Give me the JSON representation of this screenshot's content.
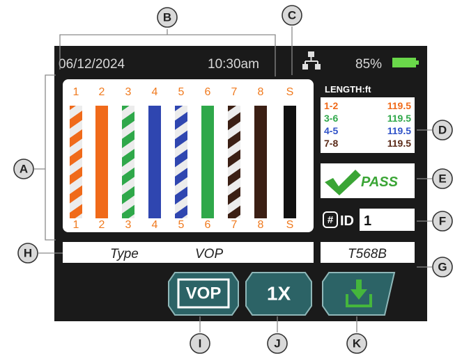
{
  "status_bar": {
    "date": "06/12/2024",
    "time": "10:30am",
    "battery": "85%"
  },
  "wiremap": {
    "pins_top": [
      "1",
      "2",
      "3",
      "4",
      "5",
      "6",
      "7",
      "8",
      "S"
    ],
    "pins_bottom": [
      "1",
      "2",
      "3",
      "4",
      "5",
      "6",
      "7",
      "8",
      "S"
    ]
  },
  "length": {
    "header": "LENGTH:ft",
    "rows": [
      {
        "pair": "1-2",
        "value": "119.5",
        "color": "#f06a1a"
      },
      {
        "pair": "3-6",
        "value": "119.5",
        "color": "#2fa84a"
      },
      {
        "pair": "4-5",
        "value": "119.5",
        "color": "#2f52c8"
      },
      {
        "pair": "7-8",
        "value": "119.5",
        "color": "#5a2a18"
      }
    ]
  },
  "result": {
    "label": "PASS"
  },
  "id_field": {
    "label": "ID",
    "value": "1"
  },
  "type_field": {
    "label": "Type",
    "value": "VOP"
  },
  "standard": {
    "value": "T568B"
  },
  "buttons": {
    "vop": "VOP",
    "zoom": "1X"
  },
  "callouts": {
    "a": "A",
    "b": "B",
    "c": "C",
    "d": "D",
    "e": "E",
    "f": "F",
    "g": "G",
    "h": "H",
    "i": "I",
    "j": "J",
    "k": "K"
  }
}
